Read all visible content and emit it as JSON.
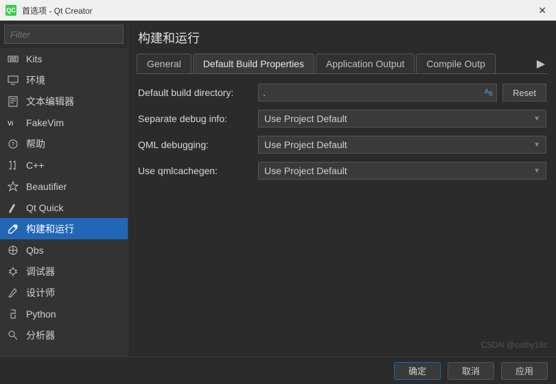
{
  "window": {
    "title": "首选项 - Qt Creator"
  },
  "sidebar": {
    "filter_placeholder": "Filter",
    "items": [
      {
        "label": "Kits",
        "icon": "kits"
      },
      {
        "label": "环境",
        "icon": "monitor"
      },
      {
        "label": "文本编辑器",
        "icon": "text-editor"
      },
      {
        "label": "FakeVim",
        "icon": "fakevim"
      },
      {
        "label": "帮助",
        "icon": "help"
      },
      {
        "label": "C++",
        "icon": "cpp"
      },
      {
        "label": "Beautifier",
        "icon": "beautifier"
      },
      {
        "label": "Qt Quick",
        "icon": "qtquick"
      },
      {
        "label": "构建和运行",
        "icon": "build",
        "selected": true
      },
      {
        "label": "Qbs",
        "icon": "qbs"
      },
      {
        "label": "调试器",
        "icon": "debugger"
      },
      {
        "label": "设计师",
        "icon": "designer"
      },
      {
        "label": "Python",
        "icon": "python"
      },
      {
        "label": "分析器",
        "icon": "analyzer"
      }
    ]
  },
  "panel": {
    "title": "构建和运行",
    "tabs": [
      "General",
      "Default Build Properties",
      "Application Output",
      "Compile Outp"
    ],
    "active_tab": 1,
    "fields": {
      "build_dir_label": "Default build directory:",
      "build_dir_value": ".",
      "reset_label": "Reset",
      "sep_debug_label": "Separate debug info:",
      "sep_debug_value": "Use Project Default",
      "qml_debug_label": "QML debugging:",
      "qml_debug_value": "Use Project Default",
      "qmlcache_label": "Use qmlcachegen:",
      "qmlcache_value": "Use Project Default"
    }
  },
  "footer": {
    "ok": "确定",
    "cancel": "取消",
    "apply": "应用"
  },
  "watermark": "CSDN @cathy18c"
}
